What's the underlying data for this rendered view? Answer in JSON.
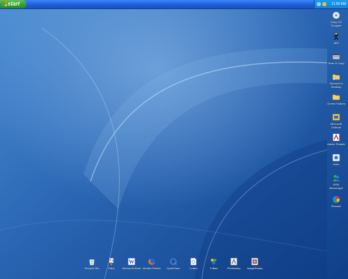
{
  "taskbar": {
    "start_label": "start",
    "clock": "11:50 AM"
  },
  "desktop_icons_right": [
    {
      "label": "Sony CD Chopper",
      "icon": "cd-chopper-icon"
    },
    {
      "label": "AIM",
      "icon": "aim-running-man-icon"
    },
    {
      "label": "Scan & Copy",
      "icon": "scanner-icon"
    },
    {
      "label": "Shortcut to Desktop",
      "icon": "folder-shortcut-icon"
    },
    {
      "label": "Green Folders",
      "icon": "folder-icon"
    },
    {
      "label": "Microsoft Outlook",
      "icon": "outlook-icon"
    },
    {
      "label": "Adobe Reader",
      "icon": "adobe-reader-icon"
    },
    {
      "label": "Hello",
      "icon": "hello-icon"
    },
    {
      "label": "MSN Messenger",
      "icon": "msn-messenger-icon"
    },
    {
      "label": "Picasa2",
      "icon": "picasa-icon"
    }
  ],
  "desktop_icons_bottom": [
    {
      "label": "Recycle Bin",
      "icon": "recycle-bin-icon"
    },
    {
      "label": "Paint",
      "icon": "paint-icon"
    },
    {
      "label": "Microsoft Word",
      "icon": "word-icon"
    },
    {
      "label": "Mozilla Firefox",
      "icon": "firefox-icon"
    },
    {
      "label": "QuickTime",
      "icon": "quicktime-icon"
    },
    {
      "label": "Loutro",
      "icon": "document-icon"
    },
    {
      "label": "Trillian",
      "icon": "trillian-icon"
    },
    {
      "label": "Photoshop",
      "icon": "photoshop-icon"
    },
    {
      "label": "ImageReady",
      "icon": "imageready-icon"
    }
  ]
}
